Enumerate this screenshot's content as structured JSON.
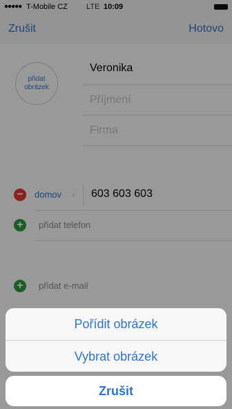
{
  "status_bar": {
    "signal": "●●●●●",
    "carrier": "T-Mobile CZ",
    "network": "LTE",
    "time": "10:09"
  },
  "nav": {
    "cancel_label": "Zrušit",
    "done_label": "Hotovo"
  },
  "contact": {
    "avatar_label": "přidat obrázek",
    "first_name": "Veronika",
    "last_name_placeholder": "Příjmení",
    "company_placeholder": "Firma"
  },
  "phone": {
    "label": "domov",
    "value": "603 603 603",
    "add_label": "přidat telefon"
  },
  "email": {
    "add_label": "přidat e-mail"
  },
  "action_sheet": {
    "take_photo_label": "Pořídit obrázek",
    "choose_photo_label": "Vybrat obrázek",
    "cancel_label": "Zrušit"
  },
  "colors": {
    "accent": "#2f74c8",
    "delete": "#e53935",
    "add": "#2e9b3f"
  }
}
